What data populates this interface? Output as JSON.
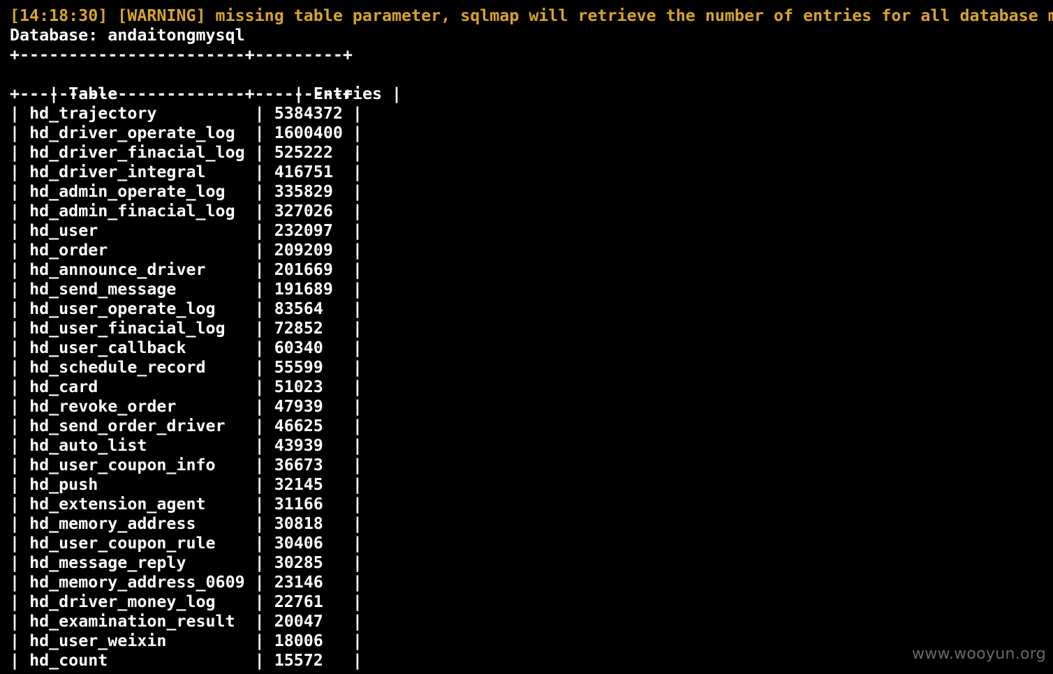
{
  "log": {
    "warning_line": "[14:18:30] [WARNING] missing table parameter, sqlmap will retrieve the number of entries for all database m",
    "database_line": "Database: andaitongmysql"
  },
  "table": {
    "border": "+-----------------------+---------+",
    "header": {
      "table": "Table",
      "entries": "Entries"
    },
    "rows": [
      {
        "name": "hd_trajectory",
        "entries": "5384372"
      },
      {
        "name": "hd_driver_operate_log",
        "entries": "1600400"
      },
      {
        "name": "hd_driver_finacial_log",
        "entries": "525222"
      },
      {
        "name": "hd_driver_integral",
        "entries": "416751"
      },
      {
        "name": "hd_admin_operate_log",
        "entries": "335829"
      },
      {
        "name": "hd_admin_finacial_log",
        "entries": "327026"
      },
      {
        "name": "hd_user",
        "entries": "232097"
      },
      {
        "name": "hd_order",
        "entries": "209209"
      },
      {
        "name": "hd_announce_driver",
        "entries": "201669"
      },
      {
        "name": "hd_send_message",
        "entries": "191689"
      },
      {
        "name": "hd_user_operate_log",
        "entries": "83564"
      },
      {
        "name": "hd_user_finacial_log",
        "entries": "72852"
      },
      {
        "name": "hd_user_callback",
        "entries": "60340"
      },
      {
        "name": "hd_schedule_record",
        "entries": "55599"
      },
      {
        "name": "hd_card",
        "entries": "51023"
      },
      {
        "name": "hd_revoke_order",
        "entries": "47939"
      },
      {
        "name": "hd_send_order_driver",
        "entries": "46625"
      },
      {
        "name": "hd_auto_list",
        "entries": "43939"
      },
      {
        "name": "hd_user_coupon_info",
        "entries": "36673"
      },
      {
        "name": "hd_push",
        "entries": "32145"
      },
      {
        "name": "hd_extension_agent",
        "entries": "31166"
      },
      {
        "name": "hd_memory_address",
        "entries": "30818"
      },
      {
        "name": "hd_user_coupon_rule",
        "entries": "30406"
      },
      {
        "name": "hd_message_reply",
        "entries": "30285"
      },
      {
        "name": "hd_memory_address_0609",
        "entries": "23146"
      },
      {
        "name": "hd_driver_money_log",
        "entries": "22761"
      },
      {
        "name": "hd_examination_result",
        "entries": "20047"
      },
      {
        "name": "hd_user_weixin",
        "entries": "18006"
      },
      {
        "name": "hd_count",
        "entries": "15572"
      }
    ]
  },
  "watermark": "www.wooyun.org",
  "colors": {
    "background": "#000000",
    "text": "#ffffff",
    "warning": "#d8a42b",
    "watermark": "#6a6a6a"
  }
}
